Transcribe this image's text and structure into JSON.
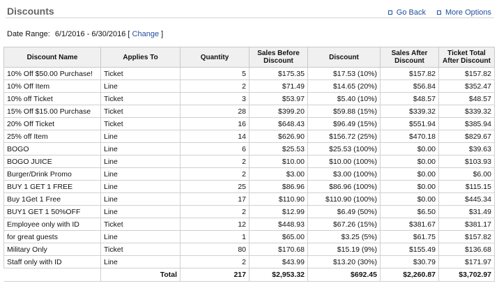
{
  "header": {
    "title": "Discounts",
    "go_back": "Go Back",
    "more_options": "More Options"
  },
  "date_range": {
    "label": "Date Range:",
    "value": "6/1/2016 - 6/30/2016",
    "open_bracket": "[",
    "change": "Change",
    "close_bracket": "]"
  },
  "table": {
    "columns": [
      "Discount Name",
      "Applies To",
      "Quantity",
      "Sales Before Discount",
      "Discount",
      "Sales After Discount",
      "Ticket Total After Discount"
    ],
    "rows": [
      [
        "10% Off $50.00 Purchase!",
        "Ticket",
        "5",
        "$175.35",
        "$17.53 (10%)",
        "$157.82",
        "$157.82"
      ],
      [
        "10% Off Item",
        "Line",
        "2",
        "$71.49",
        "$14.65 (20%)",
        "$56.84",
        "$352.47"
      ],
      [
        "10% off Ticket",
        "Ticket",
        "3",
        "$53.97",
        "$5.40 (10%)",
        "$48.57",
        "$48.57"
      ],
      [
        "15% Off $15.00 Purchase",
        "Ticket",
        "28",
        "$399.20",
        "$59.88 (15%)",
        "$339.32",
        "$339.32"
      ],
      [
        "20% Off Ticket",
        "Ticket",
        "16",
        "$648.43",
        "$96.49 (15%)",
        "$551.94",
        "$385.94"
      ],
      [
        "25% off Item",
        "Line",
        "14",
        "$626.90",
        "$156.72 (25%)",
        "$470.18",
        "$829.67"
      ],
      [
        "BOGO",
        "Line",
        "6",
        "$25.53",
        "$25.53 (100%)",
        "$0.00",
        "$39.63"
      ],
      [
        "BOGO JUICE",
        "Line",
        "2",
        "$10.00",
        "$10.00 (100%)",
        "$0.00",
        "$103.93"
      ],
      [
        "Burger/Drink Promo",
        "Line",
        "2",
        "$3.00",
        "$3.00 (100%)",
        "$0.00",
        "$6.00"
      ],
      [
        "BUY 1 GET 1 FREE",
        "Line",
        "25",
        "$86.96",
        "$86.96 (100%)",
        "$0.00",
        "$115.15"
      ],
      [
        "Buy 1Get 1 Free",
        "Line",
        "17",
        "$110.90",
        "$110.90 (100%)",
        "$0.00",
        "$445.34"
      ],
      [
        "BUY1 GET 1 50%OFF",
        "Line",
        "2",
        "$12.99",
        "$6.49 (50%)",
        "$6.50",
        "$31.49"
      ],
      [
        "Employee only with ID",
        "Ticket",
        "12",
        "$448.93",
        "$67.26 (15%)",
        "$381.67",
        "$381.17"
      ],
      [
        "for great guests",
        "Line",
        "1",
        "$65.00",
        "$3.25 (5%)",
        "$61.75",
        "$157.82"
      ],
      [
        "Military Only",
        "Ticket",
        "80",
        "$170.68",
        "$15.19 (9%)",
        "$155.49",
        "$136.68"
      ],
      [
        "Staff only with ID",
        "Line",
        "2",
        "$43.99",
        "$13.20 (30%)",
        "$30.79",
        "$171.97"
      ]
    ],
    "total": {
      "label": "Total",
      "quantity": "217",
      "sales_before": "$2,953.32",
      "discount": "$692.45",
      "sales_after": "$2,260.87",
      "ticket_total": "$3,702.97"
    }
  }
}
